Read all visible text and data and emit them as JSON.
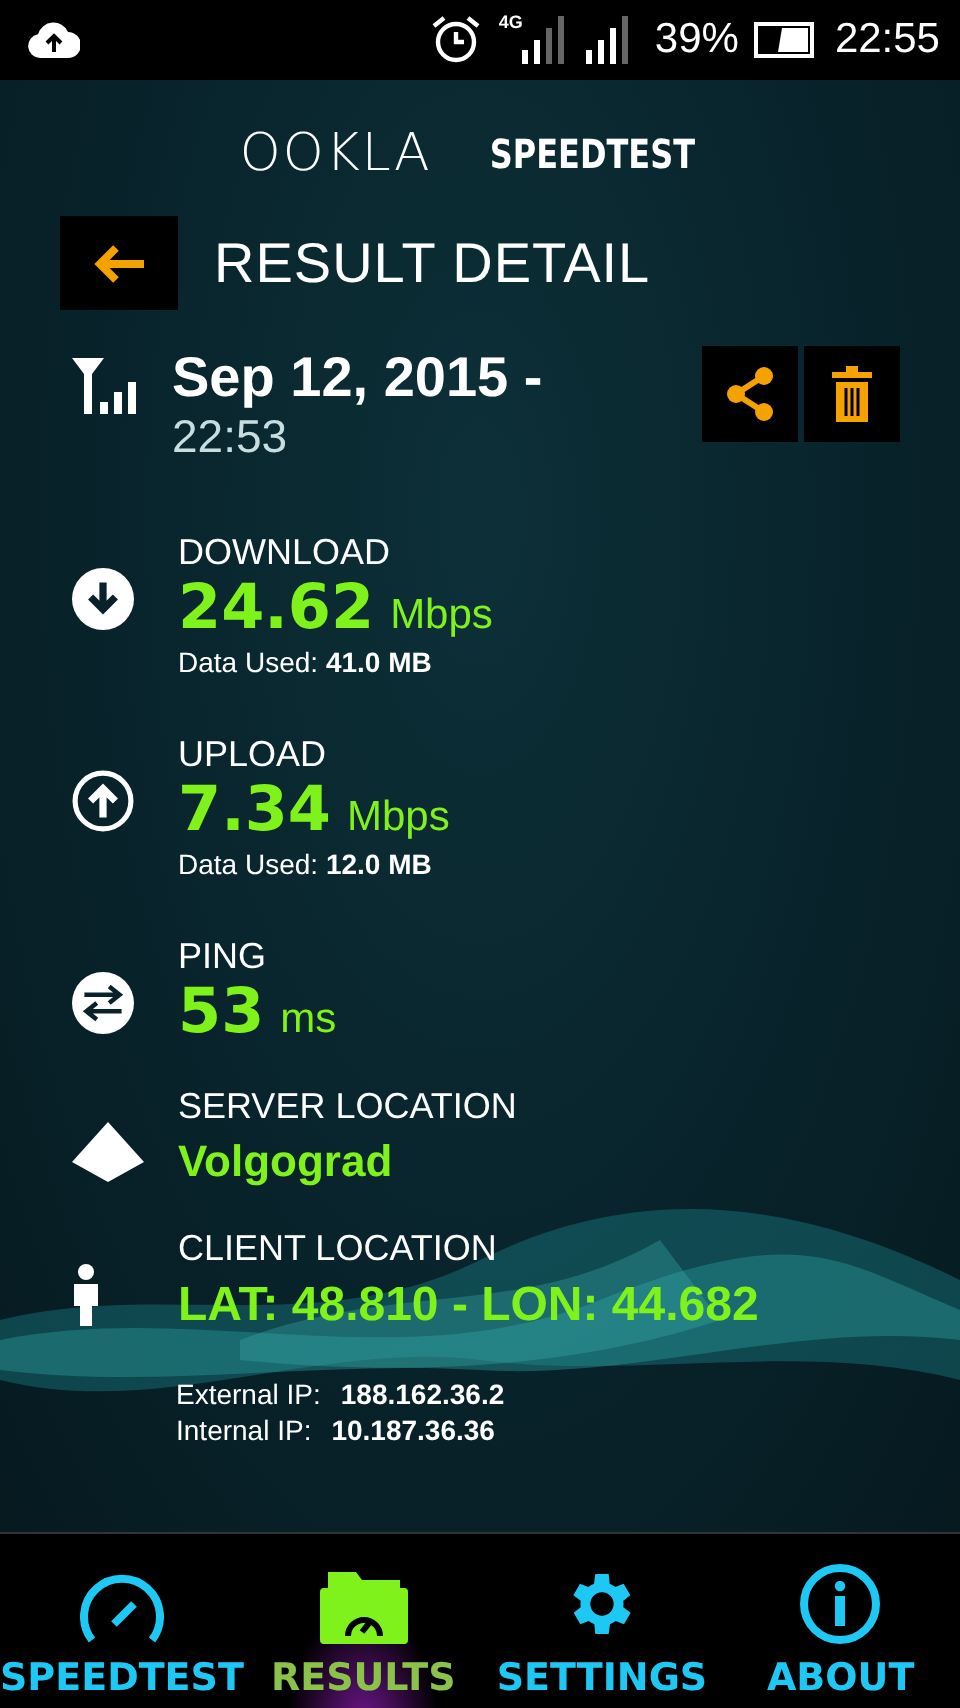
{
  "status_bar": {
    "network": "4G",
    "battery": "39%",
    "time": "22:55"
  },
  "logo": {
    "brand": "OOKLA",
    "product": "SPEEDTEST"
  },
  "header": {
    "title": "RESULT DETAIL"
  },
  "result": {
    "date": "Sep 12, 2015 -",
    "time": "22:53"
  },
  "metrics": [
    {
      "kind": "download",
      "label": "DOWNLOAD",
      "value": "24.62",
      "unit": "Mbps",
      "data_used": "Data Used: **41.0 MB**"
    },
    {
      "kind": "upload",
      "label": "UPLOAD",
      "value": "7.34",
      "unit": "Mbps",
      "data_used": "Data Used: **12.0 MB**"
    },
    {
      "kind": "ping",
      "label": "PING",
      "value": "53",
      "unit": "ms"
    },
    {
      "kind": "server",
      "label": "SERVER LOCATION",
      "value": "Volgograd"
    },
    {
      "kind": "client",
      "label": "CLIENT LOCATION",
      "value": "LAT: 48.810 - LON: 44.682"
    }
  ],
  "ips": [
    {
      "label": "External IP:",
      "value": "188.162.36.2"
    },
    {
      "label": "Internal IP:",
      "value": "10.187.36.36"
    }
  ],
  "nav": [
    {
      "kind": "speedtest",
      "label": "SPEEDTEST",
      "selected": false
    },
    {
      "kind": "results",
      "label": "RESULTS",
      "selected": true
    },
    {
      "kind": "settings",
      "label": "SETTINGS",
      "selected": false
    },
    {
      "kind": "about",
      "label": "ABOUT",
      "selected": false
    }
  ]
}
